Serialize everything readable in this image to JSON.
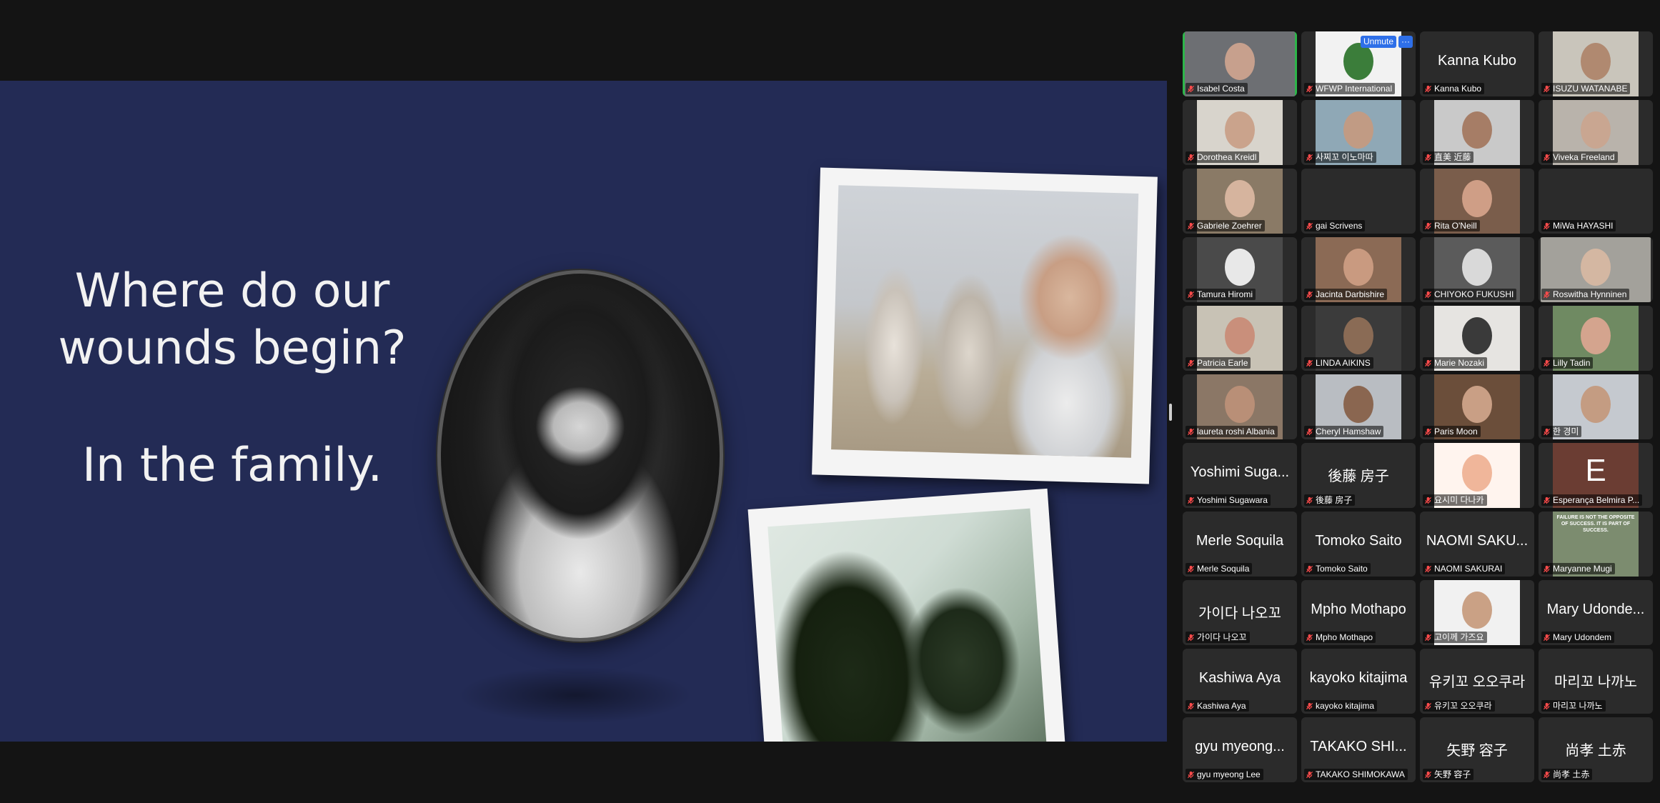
{
  "slide": {
    "line1": "Where do our",
    "line2": "wounds begin?",
    "line3": "In the family."
  },
  "gallery_controls": {
    "unmute_label": "Unmute",
    "more_label": "···"
  },
  "participants": [
    {
      "name": "Isabel Costa",
      "display": "",
      "video": true,
      "bg": "#6d6f73",
      "face": "#c7a08d",
      "active": true
    },
    {
      "name": "WFWP International",
      "display": "",
      "video": true,
      "bg": "#f2f2f2",
      "face": "#3b7d3a",
      "hover": true
    },
    {
      "name": "Kanna Kubo",
      "display": "Kanna Kubo",
      "video": false
    },
    {
      "name": "ISUZU WATANABE",
      "display": "",
      "video": true,
      "bg": "#c9c5bb",
      "face": "#b08970"
    },
    {
      "name": "Dorothea Kreidl",
      "display": "",
      "video": true,
      "bg": "#d8d4cc",
      "face": "#caa38c"
    },
    {
      "name": "사찌꼬 이노마따",
      "display": "",
      "video": true,
      "bg": "#8fa8b6",
      "face": "#c19b84"
    },
    {
      "name": "直美 近藤",
      "display": "",
      "video": true,
      "bg": "#c9c9c9",
      "face": "#a67d66"
    },
    {
      "name": "Viveka Freeland",
      "display": "",
      "video": true,
      "bg": "#b9b3ab",
      "face": "#c9a691"
    },
    {
      "name": "Gabriele Zoehrer",
      "display": "",
      "video": true,
      "bg": "#8a7a66",
      "face": "#d6b49e"
    },
    {
      "name": "gai Scrivens",
      "display": "",
      "video": false
    },
    {
      "name": "Rita O'Neill",
      "display": "",
      "video": true,
      "bg": "#7a5d4b",
      "face": "#cf9e86"
    },
    {
      "name": "MiWa HAYASHI",
      "display": "",
      "video": false
    },
    {
      "name": "Tamura Hiromi",
      "display": "",
      "video": true,
      "bg": "#4a4a4a",
      "face": "#e8e8e8"
    },
    {
      "name": "Jacinta Darbishire",
      "display": "",
      "video": true,
      "bg": "#8b6a55",
      "face": "#c99a80"
    },
    {
      "name": "CHIYOKO FUKUSHI",
      "display": "",
      "video": true,
      "bg": "#5b5b5b",
      "face": "#d9d9d9"
    },
    {
      "name": "Roswitha Hynninen",
      "display": "",
      "video": true,
      "bg": "#a3a19b",
      "face": "#d4b7a2",
      "speaking": true
    },
    {
      "name": "Patricia Earle",
      "display": "",
      "video": true,
      "bg": "#c8c2b5",
      "face": "#c98f7b"
    },
    {
      "name": "LINDA AIKINS",
      "display": "",
      "video": true,
      "bg": "#3b3b3b",
      "face": "#8a6b55"
    },
    {
      "name": "Marie Nozaki",
      "display": "",
      "video": true,
      "bg": "#e6e4e1",
      "face": "#3a3a3a"
    },
    {
      "name": "Lilly Tadin",
      "display": "",
      "video": true,
      "bg": "#6f8a62",
      "face": "#d4a48e"
    },
    {
      "name": "laureta roshi Albania",
      "display": "",
      "video": true,
      "bg": "#8b7766",
      "face": "#b98f77"
    },
    {
      "name": "Cheryl Hamshaw",
      "display": "",
      "video": true,
      "bg": "#b9bdc2",
      "face": "#8a6650"
    },
    {
      "name": "Paris Moon",
      "display": "",
      "video": true,
      "bg": "#6b4e3a",
      "face": "#c99f85"
    },
    {
      "name": "한 경미",
      "display": "",
      "video": true,
      "bg": "#c5c9cf",
      "face": "#c49c82"
    },
    {
      "name": "Yoshimi Sugawara",
      "display": "Yoshimi Suga...",
      "video": false
    },
    {
      "name": "後藤 房子",
      "display": "後藤 房子",
      "video": false
    },
    {
      "name": "요시미 다나카",
      "display": "",
      "video": true,
      "bg": "#fff4ee",
      "face": "#f0b69a"
    },
    {
      "name": "Esperança Belmira P...",
      "display": "",
      "video": true,
      "bg": "#6b3d33",
      "face": "#6b3d33",
      "letter": "E"
    },
    {
      "name": "Merle Soquila",
      "display": "Merle Soquila",
      "video": false
    },
    {
      "name": "Tomoko Saito",
      "display": "Tomoko Saito",
      "video": false
    },
    {
      "name": "NAOMI SAKURAI",
      "display": "NAOMI SAKU...",
      "video": false
    },
    {
      "name": "Maryanne Mugi",
      "display": "",
      "video": true,
      "bg": "#7c8c6f",
      "face": "#7c8c6f",
      "poster": "FAILURE IS NOT THE OPPOSITE OF SUCCESS. IT IS PART OF SUCCESS."
    },
    {
      "name": "가이다 나오꼬",
      "display": "가이다 나오꼬",
      "video": false
    },
    {
      "name": "Mpho Mothapo",
      "display": "Mpho Mothapo",
      "video": false
    },
    {
      "name": "고이께 가즈요",
      "display": "",
      "video": true,
      "bg": "#f1f1f1",
      "face": "#caa185"
    },
    {
      "name": "Mary Udondem",
      "display": "Mary Udonde...",
      "video": false
    },
    {
      "name": "Kashiwa Aya",
      "display": "Kashiwa Aya",
      "video": false
    },
    {
      "name": "kayoko kitajima",
      "display": "kayoko kitajima",
      "video": false
    },
    {
      "name": "유키꼬 오오쿠라",
      "display": "유키꼬 오오쿠라",
      "video": false
    },
    {
      "name": "마리꼬 나까노",
      "display": "마리꼬 나까노",
      "video": false
    },
    {
      "name": "gyu myeong Lee",
      "display": "gyu myeong...",
      "video": false
    },
    {
      "name": "TAKAKO SHIMOKAWA",
      "display": "TAKAKO SHI...",
      "video": false
    },
    {
      "name": "矢野 容子",
      "display": "矢野 容子",
      "video": false
    },
    {
      "name": "尚孝 土赤",
      "display": "尚孝 土赤",
      "video": false
    }
  ]
}
